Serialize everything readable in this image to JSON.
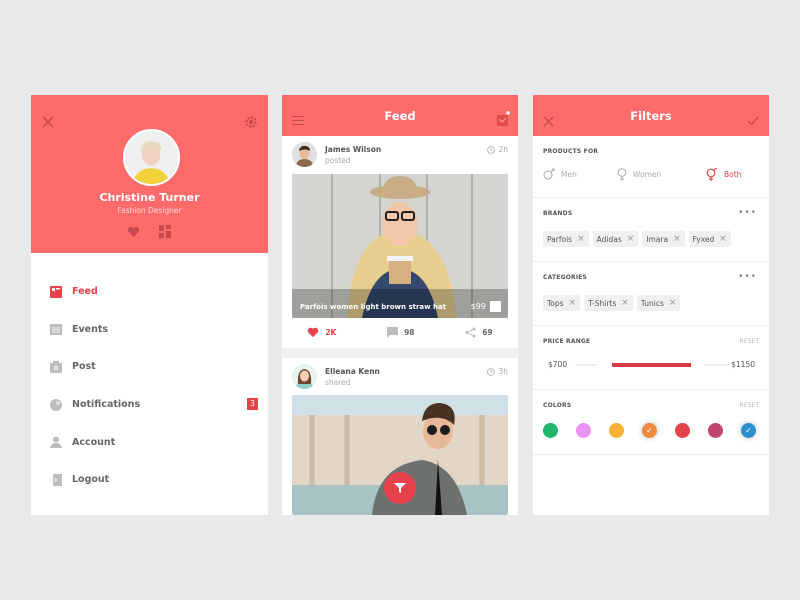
{
  "profile_screen": {
    "user": {
      "name": "Christine Turner",
      "role": "Fashion Designer"
    },
    "icons": {
      "close": "close-icon",
      "settings": "gear-icon",
      "heart": "heart-icon",
      "gallery": "gallery-icon"
    },
    "menu": [
      {
        "label": "Feed",
        "icon": "feed-icon",
        "active": true
      },
      {
        "label": "Events",
        "icon": "calendar-icon",
        "active": false
      },
      {
        "label": "Post",
        "icon": "camera-icon",
        "active": false
      },
      {
        "label": "Notifications",
        "icon": "notification-icon",
        "active": false,
        "badge": "3"
      },
      {
        "label": "Account",
        "icon": "user-icon",
        "active": false
      },
      {
        "label": "Logout",
        "icon": "logout-icon",
        "active": false
      }
    ]
  },
  "feed_screen": {
    "title": "Feed",
    "posts": [
      {
        "author": "James Wilson",
        "action": "posted",
        "time": "2h",
        "caption": "Parfois women light brown straw hat",
        "price": "$99",
        "likes": "2K",
        "comments": "98",
        "shares": "69"
      },
      {
        "author": "Elleana Kenn",
        "action": "shared",
        "time": "3h"
      }
    ]
  },
  "filters_screen": {
    "title": "Filters",
    "products_for": {
      "label": "PRODUCTS FOR",
      "options": [
        "Men",
        "Women",
        "Both"
      ],
      "selected": "Both"
    },
    "brands": {
      "label": "BRANDS",
      "items": [
        "Parfois",
        "Adidas",
        "Imara",
        "Fyxed"
      ]
    },
    "categories": {
      "label": "CATEGORIES",
      "items": [
        "Tops",
        "T-Shirts",
        "Tunics"
      ]
    },
    "price_range": {
      "label": "PRICE RANGE",
      "reset": "RESET",
      "min": "$700",
      "max": "$1150"
    },
    "colors": {
      "label": "COLORS",
      "reset": "RESET",
      "swatches": [
        {
          "hex": "#1fb56c",
          "selected": false
        },
        {
          "hex": "#ea92f2",
          "selected": false
        },
        {
          "hex": "#f7b032",
          "selected": false
        },
        {
          "hex": "#ef8a40",
          "selected": true
        },
        {
          "hex": "#e5434b",
          "selected": false
        },
        {
          "hex": "#c0466f",
          "selected": false
        },
        {
          "hex": "#2f8fcf",
          "selected": true
        }
      ]
    },
    "accent": "#e7414b"
  }
}
